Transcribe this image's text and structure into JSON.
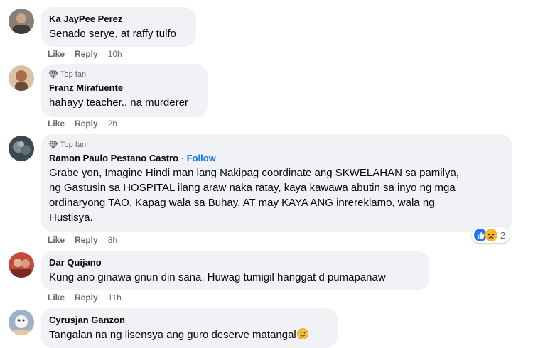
{
  "comments": [
    {
      "author": "Ka JayPee Perez",
      "text": "Senado serye, at raffy tulfo",
      "like": "Like",
      "reply": "Reply",
      "time": "10h"
    },
    {
      "badge": "Top fan",
      "author": "Franz Mirafuente",
      "text": "hahayy teacher.. na murderer",
      "like": "Like",
      "reply": "Reply",
      "time": "2h"
    },
    {
      "badge": "Top fan",
      "author": "Ramon Paulo Pestano Castro",
      "separator": "·",
      "follow": "Follow",
      "lines": [
        "Grabe yon, Imagine Hindi man lang Nakipag coordinate ang SKWELAHAN sa pamilya,",
        "ng Gastusin sa HOSPITAL ilang araw naka ratay, kaya kawawa abutin sa inyo ng mga",
        "ordinaryong TAO. Kapag wala sa Buhay, AT may KAYA ANG inrereklamo, wala ng",
        "Hustisya."
      ],
      "like": "Like",
      "reply": "Reply",
      "time": "8h",
      "reaction_count": "2",
      "reaction_icons": [
        "like-icon",
        "sad-icon"
      ]
    },
    {
      "author": "Dar Quijano",
      "text": "Kung ano ginawa gnun din sana. Huwag tumigil hanggat d pumapanaw",
      "like": "Like",
      "reply": "Reply",
      "time": "11h"
    },
    {
      "author": "Cyrusjan Ganzon",
      "text": "Tangalan na ng lisensya ang guro deserve matangal",
      "trailing_icon": "smile-icon"
    }
  ],
  "colors": {
    "bubble": "#f0f2f5",
    "meta": "#65676b",
    "link": "#1877f2",
    "text": "#050505"
  }
}
